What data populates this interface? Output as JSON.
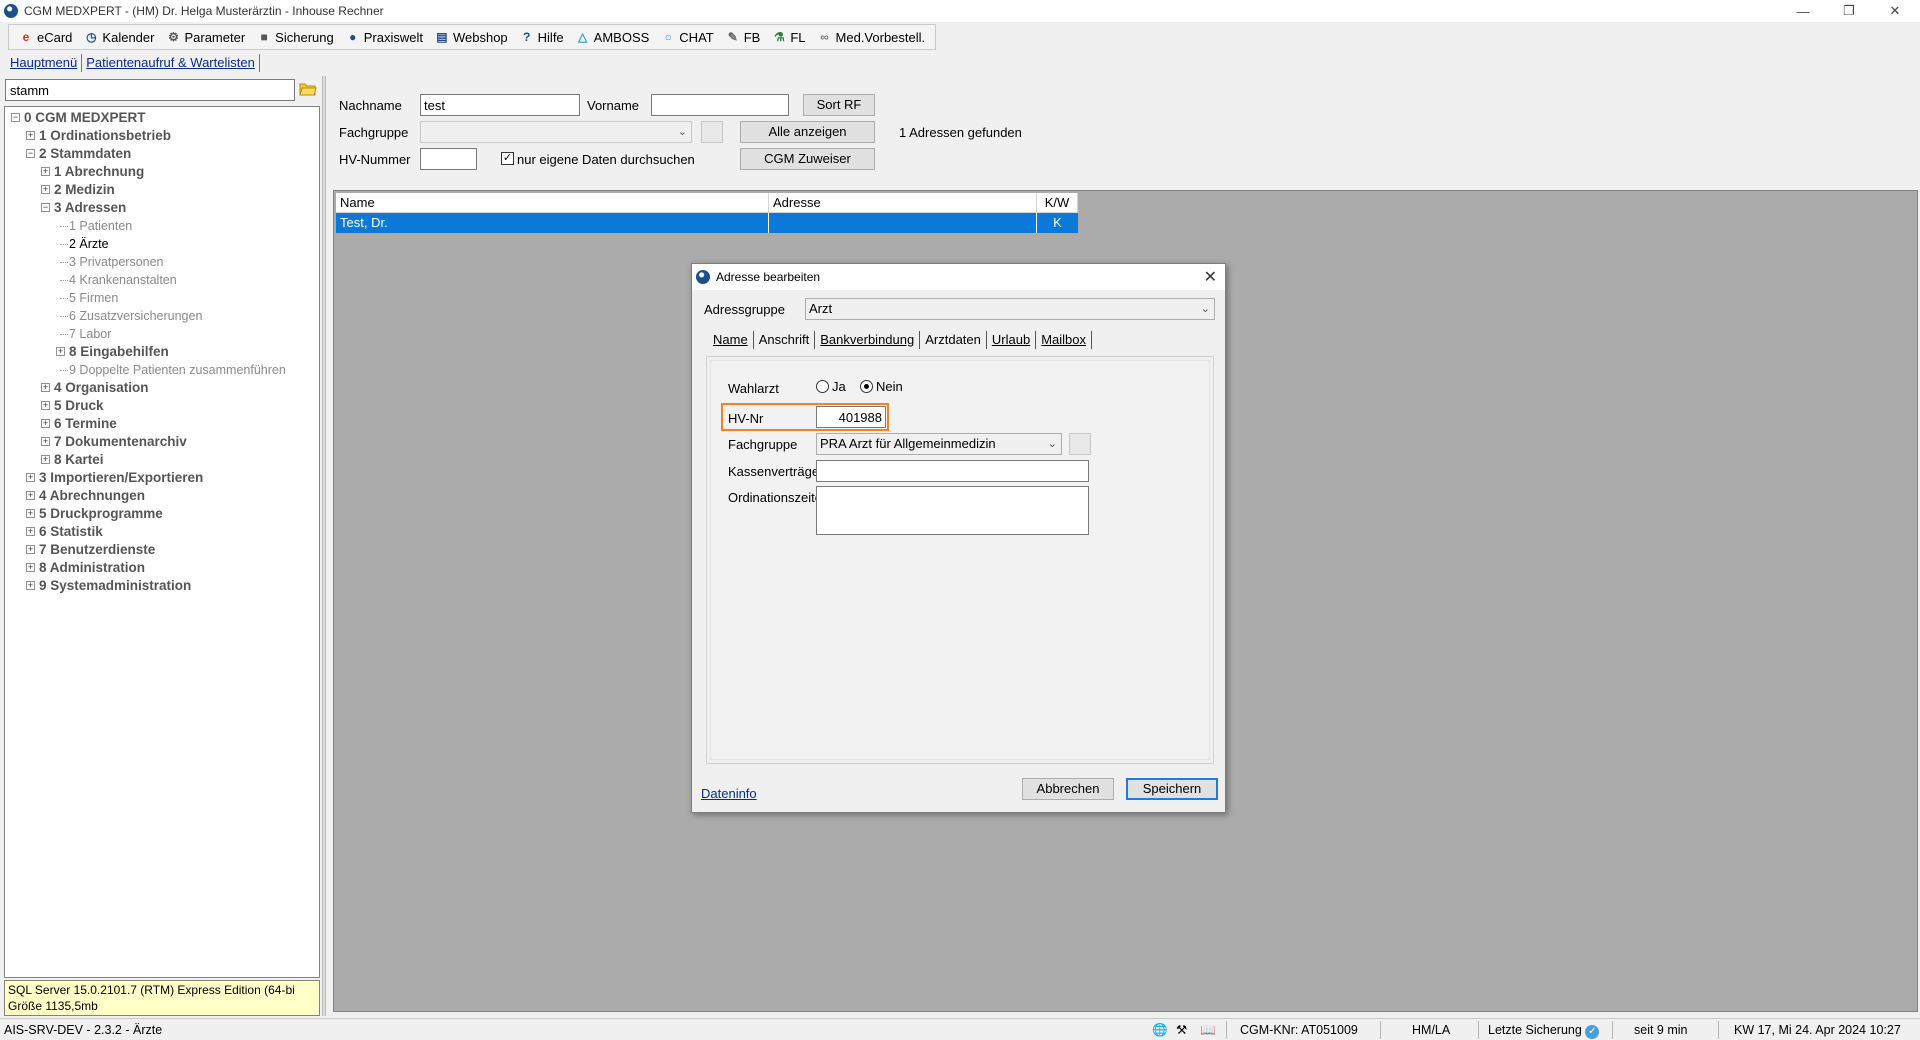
{
  "window": {
    "title": "CGM MEDXPERT - (HM) Dr. Helga Musterärztin - Inhouse Rechner"
  },
  "toolbar": {
    "items": [
      {
        "label": "eCard",
        "icon": "ecard-icon"
      },
      {
        "label": "Kalender",
        "icon": "calendar-icon"
      },
      {
        "label": "Parameter",
        "icon": "gear-icon"
      },
      {
        "label": "Sicherung",
        "icon": "backup-icon"
      },
      {
        "label": "Praxiswelt",
        "icon": "globe-icon"
      },
      {
        "label": "Webshop",
        "icon": "cart-icon"
      },
      {
        "label": "Hilfe",
        "icon": "help-icon"
      },
      {
        "label": "AMBOSS",
        "icon": "amboss-icon"
      },
      {
        "label": "CHAT",
        "icon": "chat-icon"
      },
      {
        "label": "FB",
        "icon": "document-icon"
      },
      {
        "label": "FL",
        "icon": "lab-icon"
      },
      {
        "label": "Med.Vorbestell.",
        "icon": "link-icon"
      }
    ]
  },
  "menu_tabs": [
    "Hauptmenü",
    "Patientenaufruf & Wartelisten"
  ],
  "left": {
    "search_value": "stamm",
    "tree": [
      {
        "label": "0 CGM MEDXPERT",
        "level": 0,
        "exp": "−"
      },
      {
        "label": "1 Ordinationsbetrieb",
        "level": 1,
        "exp": "+"
      },
      {
        "label": "2 Stammdaten",
        "level": 1,
        "exp": "−"
      },
      {
        "label": "1 Abrechnung",
        "level": 2,
        "exp": "+"
      },
      {
        "label": "2 Medizin",
        "level": 2,
        "exp": "+"
      },
      {
        "label": "3 Adressen",
        "level": 2,
        "exp": "−"
      },
      {
        "label": "1 Patienten",
        "level": 3,
        "exp": ""
      },
      {
        "label": "2 Ärzte",
        "level": 3,
        "exp": "",
        "selected": true
      },
      {
        "label": "3 Privatpersonen",
        "level": 3,
        "exp": ""
      },
      {
        "label": "4 Krankenanstalten",
        "level": 3,
        "exp": ""
      },
      {
        "label": "5 Firmen",
        "level": 3,
        "exp": ""
      },
      {
        "label": "6 Zusatzversicherungen",
        "level": 3,
        "exp": ""
      },
      {
        "label": "7 Labor",
        "level": 3,
        "exp": ""
      },
      {
        "label": "8 Eingabehilfen",
        "level": 3,
        "exp": "+"
      },
      {
        "label": "9 Doppelte Patienten zusammenführen",
        "level": 3,
        "exp": ""
      },
      {
        "label": "4 Organisation",
        "level": 2,
        "exp": "+"
      },
      {
        "label": "5 Druck",
        "level": 2,
        "exp": "+"
      },
      {
        "label": "6 Termine",
        "level": 2,
        "exp": "+"
      },
      {
        "label": "7 Dokumentenarchiv",
        "level": 2,
        "exp": "+"
      },
      {
        "label": "8 Kartei",
        "level": 2,
        "exp": "+"
      },
      {
        "label": "3 Importieren/Exportieren",
        "level": 1,
        "exp": "+"
      },
      {
        "label": "4 Abrechnungen",
        "level": 1,
        "exp": "+"
      },
      {
        "label": "5 Druckprogramme",
        "level": 1,
        "exp": "+"
      },
      {
        "label": "6 Statistik",
        "level": 1,
        "exp": "+"
      },
      {
        "label": "7 Benutzerdienste",
        "level": 1,
        "exp": "+"
      },
      {
        "label": "8 Administration",
        "level": 1,
        "exp": "+"
      },
      {
        "label": "9 Systemadministration",
        "level": 1,
        "exp": "+"
      }
    ],
    "status_line1": "SQL Server 15.0.2101.7 (RTM) Express Edition (64-bi",
    "status_line2": "Größe 1135,5mb"
  },
  "filter": {
    "nachname_label": "Nachname",
    "nachname_value": "test",
    "vorname_label": "Vorname",
    "vorname_value": "",
    "sort_button": "Sort RF",
    "fachgruppe_label": "Fachgruppe",
    "fachgruppe_value": "",
    "alle_button": "Alle anzeigen",
    "result_text": "1 Adressen gefunden",
    "hv_label": "HV-Nummer",
    "hv_value": "",
    "eigene_label": "nur eigene Daten durchsuchen",
    "eigene_checked": true,
    "zuweiser_button": "CGM Zuweiser"
  },
  "grid": {
    "columns": [
      "Name",
      "Adresse",
      "K/W"
    ],
    "rows": [
      {
        "name": "Test, Dr.",
        "adresse": "",
        "kw": "K"
      }
    ]
  },
  "dialog": {
    "title": "Adresse bearbeiten",
    "adressgruppe_label": "Adressgruppe",
    "adressgruppe_value": "Arzt",
    "tabs": [
      "Name",
      "Anschrift",
      "Bankverbindung",
      "Arztdaten",
      "Urlaub",
      "Mailbox"
    ],
    "active_tab": "Arztdaten",
    "wahlarzt_label": "Wahlarzt",
    "ja_label": "Ja",
    "nein_label": "Nein",
    "wahlarzt_selected": "Nein",
    "hvnr_label": "HV-Nr",
    "hvnr_value": "401988",
    "fachgruppe_label": "Fachgruppe",
    "fachgruppe_value": "PRA Arzt für Allgemeinmedizin",
    "kassen_label": "Kassenverträge",
    "kassen_value": "",
    "ordzeiten_label": "Ordinationszeiten",
    "ordzeiten_value": "",
    "dateninfo_link": "Dateninfo",
    "cancel_button": "Abbrechen",
    "save_button": "Speichern",
    "highlight_color": "#f08326"
  },
  "statusbar": {
    "left": "AIS-SRV-DEV - 2.3.2 - Ärzte",
    "knr": "CGM-KNr: AT051009",
    "user": "HM/LA",
    "backup": "Letzte Sicherung",
    "since": "seit 9 min",
    "datetime": "KW 17, Mi 24. Apr 2024  10:27"
  }
}
